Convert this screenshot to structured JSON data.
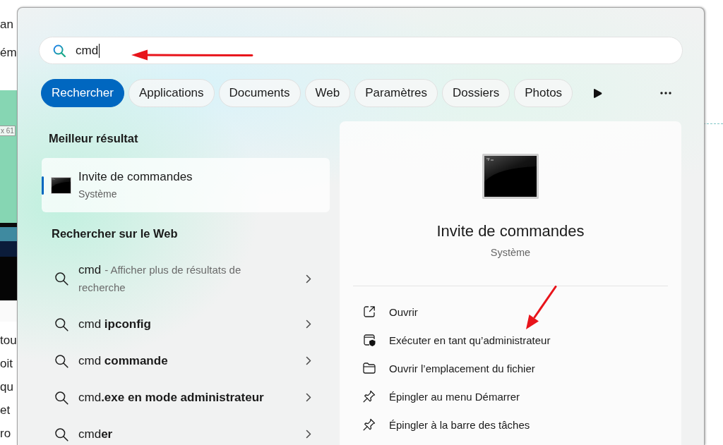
{
  "background_page": {
    "lines_top": [
      "an",
      "ém"
    ],
    "image": {
      "label": "x 61"
    },
    "lines_bottom": [
      "tou",
      "oit",
      "qu",
      "et",
      "ro"
    ]
  },
  "search": {
    "value": "cmd",
    "arrow": true
  },
  "filters": [
    {
      "label": "Rechercher",
      "selected": true
    },
    {
      "label": "Applications",
      "selected": false
    },
    {
      "label": "Documents",
      "selected": false
    },
    {
      "label": "Web",
      "selected": false
    },
    {
      "label": "Paramètres",
      "selected": false
    },
    {
      "label": "Dossiers",
      "selected": false
    },
    {
      "label": "Photos",
      "selected": false
    }
  ],
  "best_match": {
    "heading": "Meilleur résultat",
    "title": "Invite de commandes",
    "subtitle": "Système",
    "selected": true
  },
  "web": {
    "heading": "Rechercher sur le Web",
    "suggestions": [
      {
        "text": "cmd",
        "hint": "- Afficher plus de résultats de recherche"
      },
      {
        "text": "cmd **ipconfig**"
      },
      {
        "text": "cmd **commande**"
      },
      {
        "text": "cmd**.exe en mode administrateur**"
      },
      {
        "text": "cmd**er**"
      }
    ]
  },
  "details": {
    "title": "Invite de commandes",
    "subtitle": "Système",
    "arrow": true,
    "actions": [
      {
        "kind": "open",
        "label": "Ouvrir"
      },
      {
        "kind": "admin",
        "label": "Exécuter en tant qu’administrateur"
      },
      {
        "kind": "folder",
        "label": "Ouvrir l’emplacement du fichier"
      },
      {
        "kind": "pin",
        "label": "Épingler au menu Démarrer"
      },
      {
        "kind": "pin",
        "label": "Épingler à la barre des tâches"
      }
    ]
  }
}
